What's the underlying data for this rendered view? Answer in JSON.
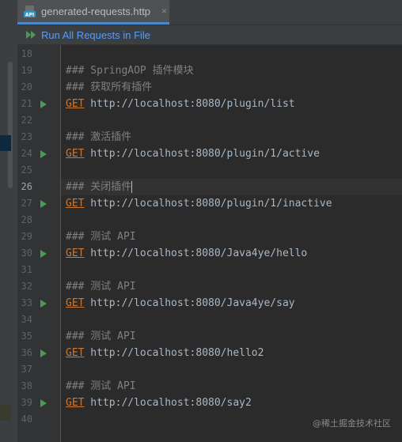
{
  "tab": {
    "title": "generated-requests.http",
    "close": "×",
    "icon": "api-file-icon",
    "icon_text": "API"
  },
  "toolbar": {
    "run_all_label": "Run All Requests in File",
    "run_all_icon": "run-all-icon"
  },
  "editor": {
    "current_line": 26,
    "lines": [
      {
        "num": "18",
        "type": "empty",
        "text": "",
        "run": false
      },
      {
        "num": "19",
        "type": "comment",
        "text": "### SpringAOP 插件模块",
        "run": false
      },
      {
        "num": "20",
        "type": "comment",
        "text": "### 获取所有插件",
        "run": false
      },
      {
        "num": "21",
        "type": "request",
        "method": "GET",
        "url": " http://localhost:8080/plugin/list",
        "run": true
      },
      {
        "num": "22",
        "type": "empty",
        "text": "",
        "run": false
      },
      {
        "num": "23",
        "type": "comment",
        "text": "### 激活插件",
        "run": false
      },
      {
        "num": "24",
        "type": "request",
        "method": "GET",
        "url": " http://localhost:8080/plugin/1/active",
        "run": true
      },
      {
        "num": "25",
        "type": "empty",
        "text": "",
        "run": false
      },
      {
        "num": "26",
        "type": "comment",
        "text": "### 关闭插件",
        "run": false,
        "caret": true
      },
      {
        "num": "27",
        "type": "request",
        "method": "GET",
        "url": " http://localhost:8080/plugin/1/inactive",
        "run": true
      },
      {
        "num": "28",
        "type": "empty",
        "text": "",
        "run": false
      },
      {
        "num": "29",
        "type": "comment",
        "text": "### 测试 API",
        "run": false
      },
      {
        "num": "30",
        "type": "request",
        "method": "GET",
        "url": " http://localhost:8080/Java4ye/hello",
        "run": true
      },
      {
        "num": "31",
        "type": "empty",
        "text": "",
        "run": false
      },
      {
        "num": "32",
        "type": "comment",
        "text": "### 测试 API",
        "run": false
      },
      {
        "num": "33",
        "type": "request",
        "method": "GET",
        "url": " http://localhost:8080/Java4ye/say",
        "run": true
      },
      {
        "num": "34",
        "type": "empty",
        "text": "",
        "run": false
      },
      {
        "num": "35",
        "type": "comment",
        "text": "### 测试 API",
        "run": false
      },
      {
        "num": "36",
        "type": "request",
        "method": "GET",
        "url": " http://localhost:8080/hello2",
        "run": true
      },
      {
        "num": "37",
        "type": "empty",
        "text": "",
        "run": false
      },
      {
        "num": "38",
        "type": "comment",
        "text": "### 测试 API",
        "run": false
      },
      {
        "num": "39",
        "type": "request",
        "method": "GET",
        "url": " http://localhost:8080/say2",
        "run": true
      },
      {
        "num": "40",
        "type": "empty",
        "text": "",
        "run": false
      }
    ]
  },
  "watermark": "@稀土掘金技术社区",
  "colors": {
    "run_arrow": "#499c54",
    "method": "#cc7832",
    "comment": "#808080",
    "url": "#a9b7c6",
    "link": "#589df6"
  }
}
